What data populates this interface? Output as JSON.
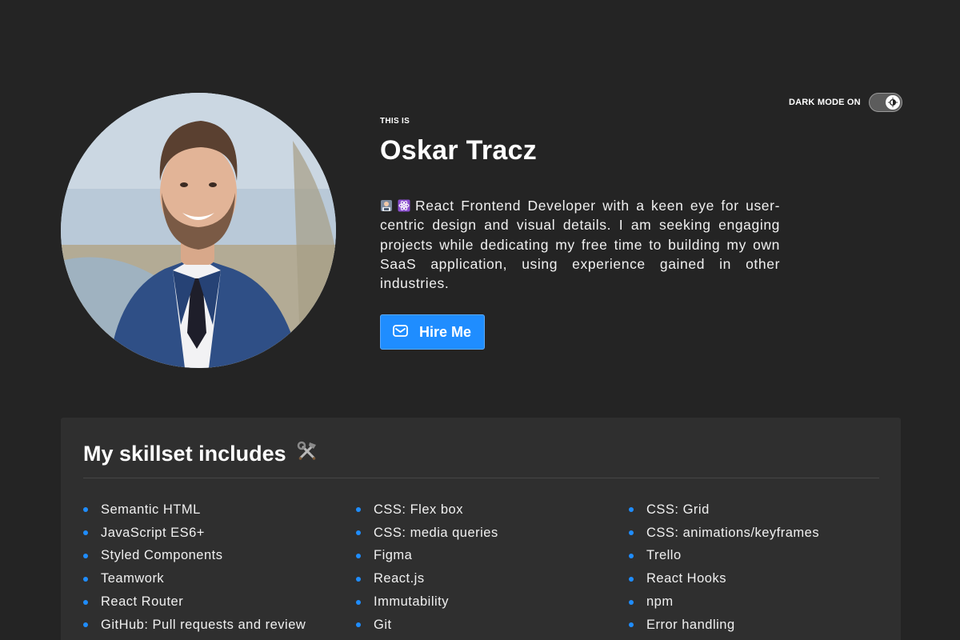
{
  "header": {
    "dark_mode_label": "DARK MODE ON",
    "dark_mode_enabled": true
  },
  "hero": {
    "eyebrow": "THIS IS",
    "name": "Oskar Tracz",
    "bio_icons": [
      "man-technologist-emoji",
      "atom-emoji"
    ],
    "bio": "React Frontend Developer with a keen eye for user-centric design and visual details. I am seeking engaging projects while dedicating my free time to building my own SaaS application, using experience gained in other industries.",
    "cta_label": "Hire Me",
    "cta_icon": "mail-icon"
  },
  "skills": {
    "title": "My skillset includes",
    "title_icon": "hammer-and-wrench-icon",
    "items": [
      "Semantic HTML",
      "CSS: Flex box",
      "CSS: Grid",
      "JavaScript ES6+",
      "CSS: media queries",
      "CSS: animations/keyframes",
      "Styled Components",
      "Figma",
      "Trello",
      "Teamwork",
      "React.js",
      "React Hooks",
      "React Router",
      "Immutability",
      "npm",
      "GitHub: Pull requests and review",
      "Git",
      "Error handling"
    ]
  },
  "colors": {
    "background": "#242424",
    "card": "#2f2f2f",
    "accent": "#1f8dff"
  }
}
